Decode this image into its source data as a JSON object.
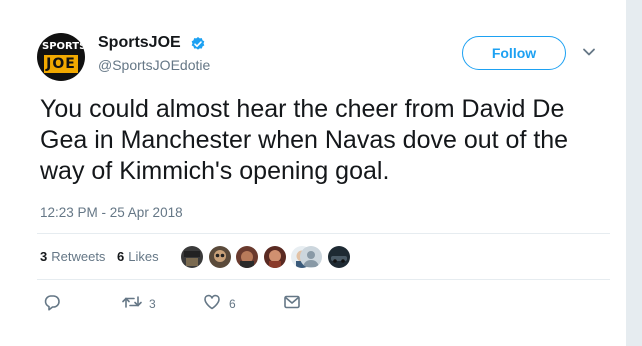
{
  "account": {
    "logo_top": "SPORTS",
    "logo_bottom": "JOE",
    "name": "SportsJOE",
    "handle": "@SportsJOEdotie"
  },
  "follow_label": "Follow",
  "tweet": {
    "text": "You could almost hear the cheer from David De Gea in Manchester when Navas dove out of the way of Kimmich's opening goal.",
    "timestamp": "12:23 PM - 25 Apr 2018"
  },
  "stats": {
    "retweets_count": "3",
    "retweets_label": "Retweets",
    "likes_count": "6",
    "likes_label": "Likes"
  },
  "actions": {
    "reply_icon": "reply-icon",
    "retweet_icon": "retweet-icon",
    "retweet_count": "3",
    "like_icon": "heart-icon",
    "like_count": "6",
    "dm_icon": "envelope-icon"
  },
  "colors": {
    "accent": "#1da1f2",
    "text": "#14171a",
    "secondary": "#657786",
    "logo_yellow": "#f2a900"
  }
}
